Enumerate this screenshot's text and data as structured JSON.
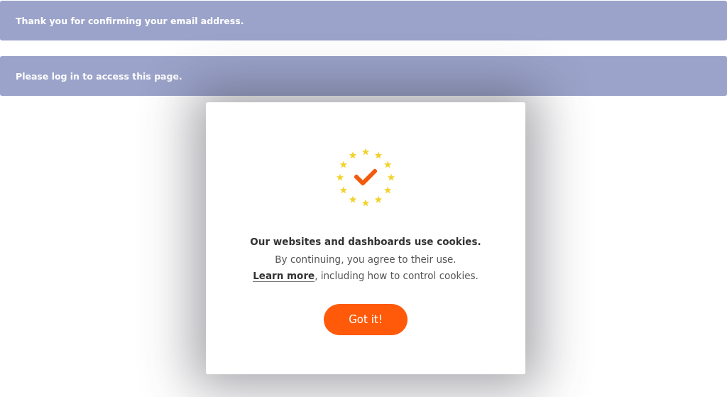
{
  "messages": [
    "Thank you for confirming your email address.",
    "Please log in to access this page."
  ],
  "cookie_dialog": {
    "title": "Our websites and dashboards use cookies.",
    "text_before": "By continuing, you agree to their use. ",
    "link": "Learn more",
    "text_after": ", including how to control cookies.",
    "button": "Got it!"
  }
}
